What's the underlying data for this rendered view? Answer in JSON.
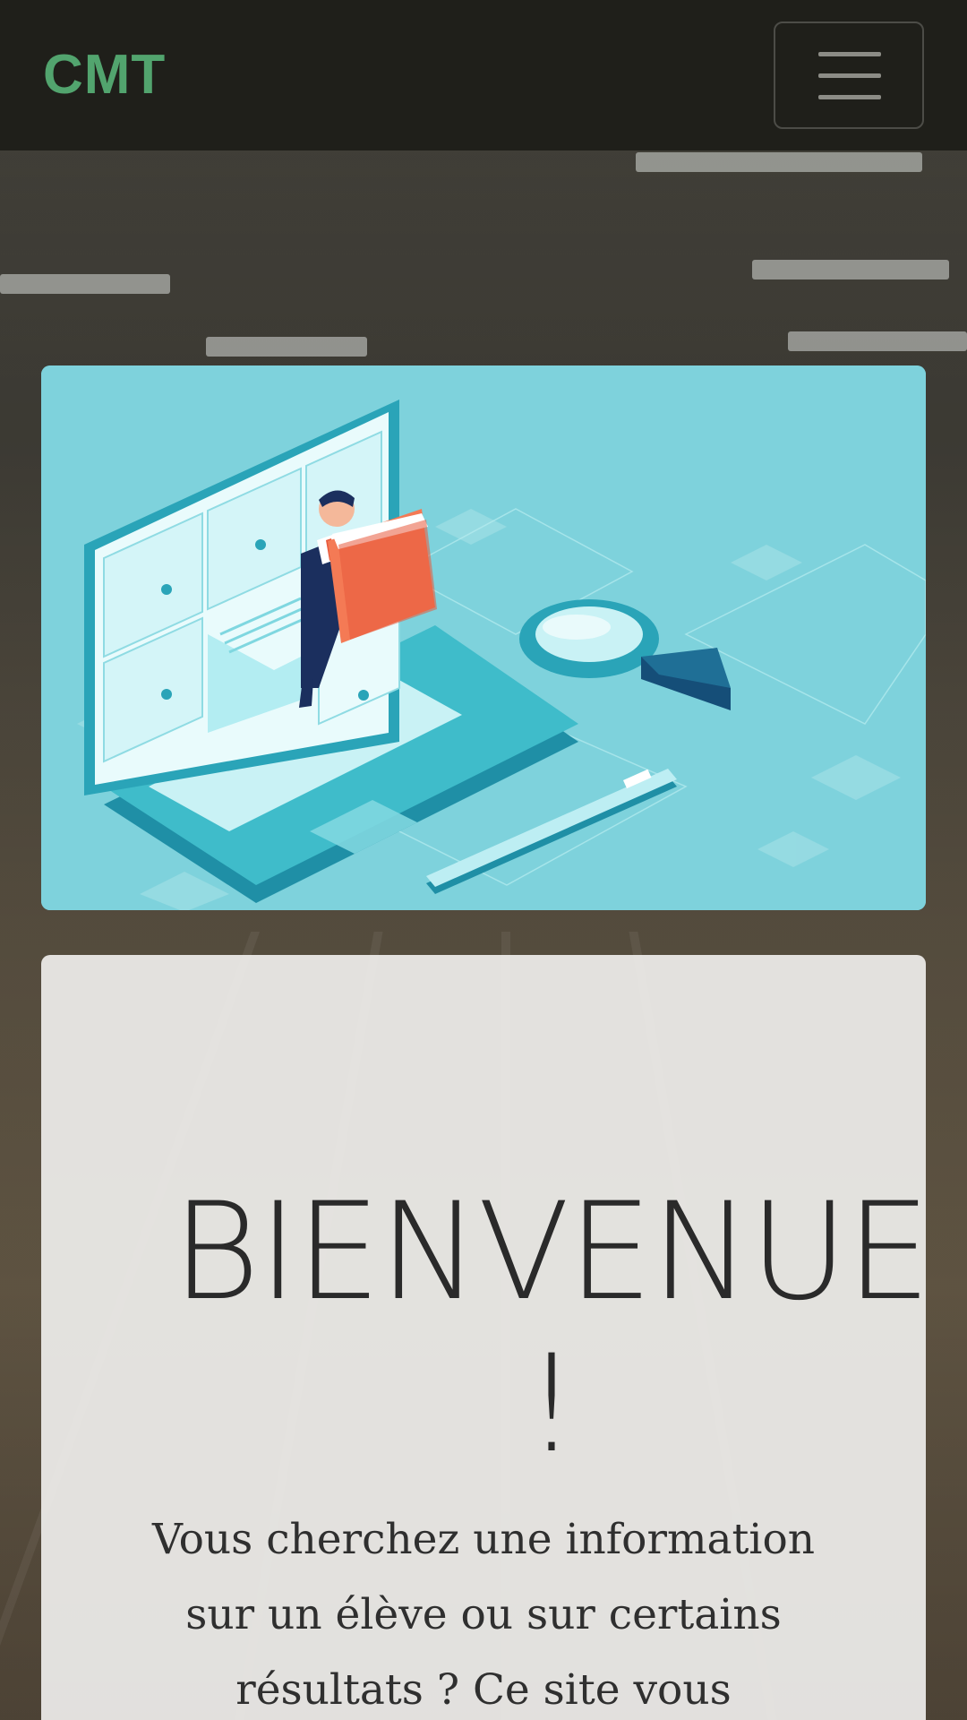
{
  "navbar": {
    "brand": "CMT",
    "menu_toggle_label": "Toggle navigation"
  },
  "hero": {
    "illustration_alt": "Illustration"
  },
  "welcome": {
    "title_line1": "BIENVENUE",
    "title_line2": "!",
    "intro_text": "Vous cherchez une information sur un élève ou sur certains résultats ? Ce site vous permettra de consulter"
  },
  "colors": {
    "brand": "#52a46e",
    "navbar_bg": "#1f1f1a",
    "illustration_bg": "#7ed2dc",
    "card_bg": "#eeedeb"
  },
  "icons": {
    "menu_toggle": "hamburger-icon"
  }
}
